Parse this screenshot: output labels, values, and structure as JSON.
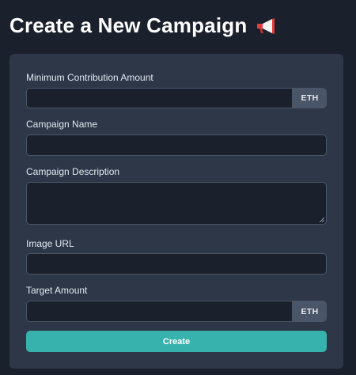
{
  "page": {
    "title": "Create a New Campaign",
    "title_icon": "megaphone-icon"
  },
  "form": {
    "min_contribution": {
      "label": "Minimum Contribution Amount",
      "value": "",
      "placeholder": "",
      "unit": "ETH"
    },
    "campaign_name": {
      "label": "Campaign Name",
      "value": "",
      "placeholder": ""
    },
    "campaign_description": {
      "label": "Campaign Description",
      "value": "",
      "placeholder": ""
    },
    "image_url": {
      "label": "Image URL",
      "value": "",
      "placeholder": ""
    },
    "target_amount": {
      "label": "Target Amount",
      "value": "",
      "placeholder": "",
      "unit": "ETH"
    },
    "submit_label": "Create"
  },
  "colors": {
    "background": "#1a202c",
    "card": "#2d3748",
    "input_border": "#4a5568",
    "accent": "#38b2ac"
  }
}
